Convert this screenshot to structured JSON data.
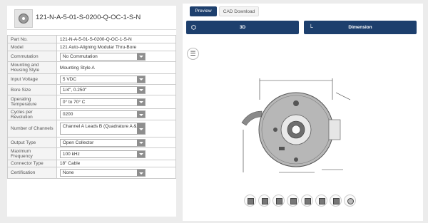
{
  "product": {
    "title": "121-N-A-5-01-S-0200-Q-OC-1-S-N"
  },
  "specs": [
    {
      "label": "Part No.",
      "value": "121-N-A-5-01-S-0200-Q-OC-1-S-N",
      "type": "text"
    },
    {
      "label": "Model",
      "value": "121 Auto-Aligning Modular Thru-Bore",
      "type": "text"
    },
    {
      "label": "Commutation",
      "value": "No Commutation",
      "type": "select"
    },
    {
      "label": "Mounting and Housing Style",
      "value": "Mounting Style A",
      "type": "text"
    },
    {
      "label": "Input Voltage",
      "value": "5 VDC",
      "type": "select"
    },
    {
      "label": "Bore Size",
      "value": "1/4\", 0.250\"",
      "type": "select"
    },
    {
      "label": "Operating Temperature",
      "value": "0° to 70° C",
      "type": "select"
    },
    {
      "label": "Cycles per Revolution",
      "value": "0200",
      "type": "select"
    },
    {
      "label": "Number of Channels",
      "value": "Channel A Leads B (Quadrature A & B)",
      "type": "select"
    },
    {
      "label": "Output Type",
      "value": "Open Collector",
      "type": "select"
    },
    {
      "label": "Maximum Frequency",
      "value": "100 kHz",
      "type": "select"
    },
    {
      "label": "Connector Type",
      "value": "18\" Cable",
      "type": "text"
    },
    {
      "label": "Certification",
      "value": "None",
      "type": "select"
    }
  ],
  "viewer": {
    "tabs": [
      "Preview",
      "CAD Download"
    ],
    "btn_3d": "3D",
    "btn_dimension": "Dimension",
    "menu_icon": "list-icon",
    "view_buttons": [
      "front-view-icon",
      "back-view-icon",
      "left-view-icon",
      "right-view-icon",
      "top-view-icon",
      "bottom-view-icon",
      "iso-view-icon",
      "reset-view-icon"
    ]
  },
  "colors": {
    "primary": "#1d3f6d",
    "select_arrow": "#8e8e8e",
    "page_bg": "#ececec"
  }
}
